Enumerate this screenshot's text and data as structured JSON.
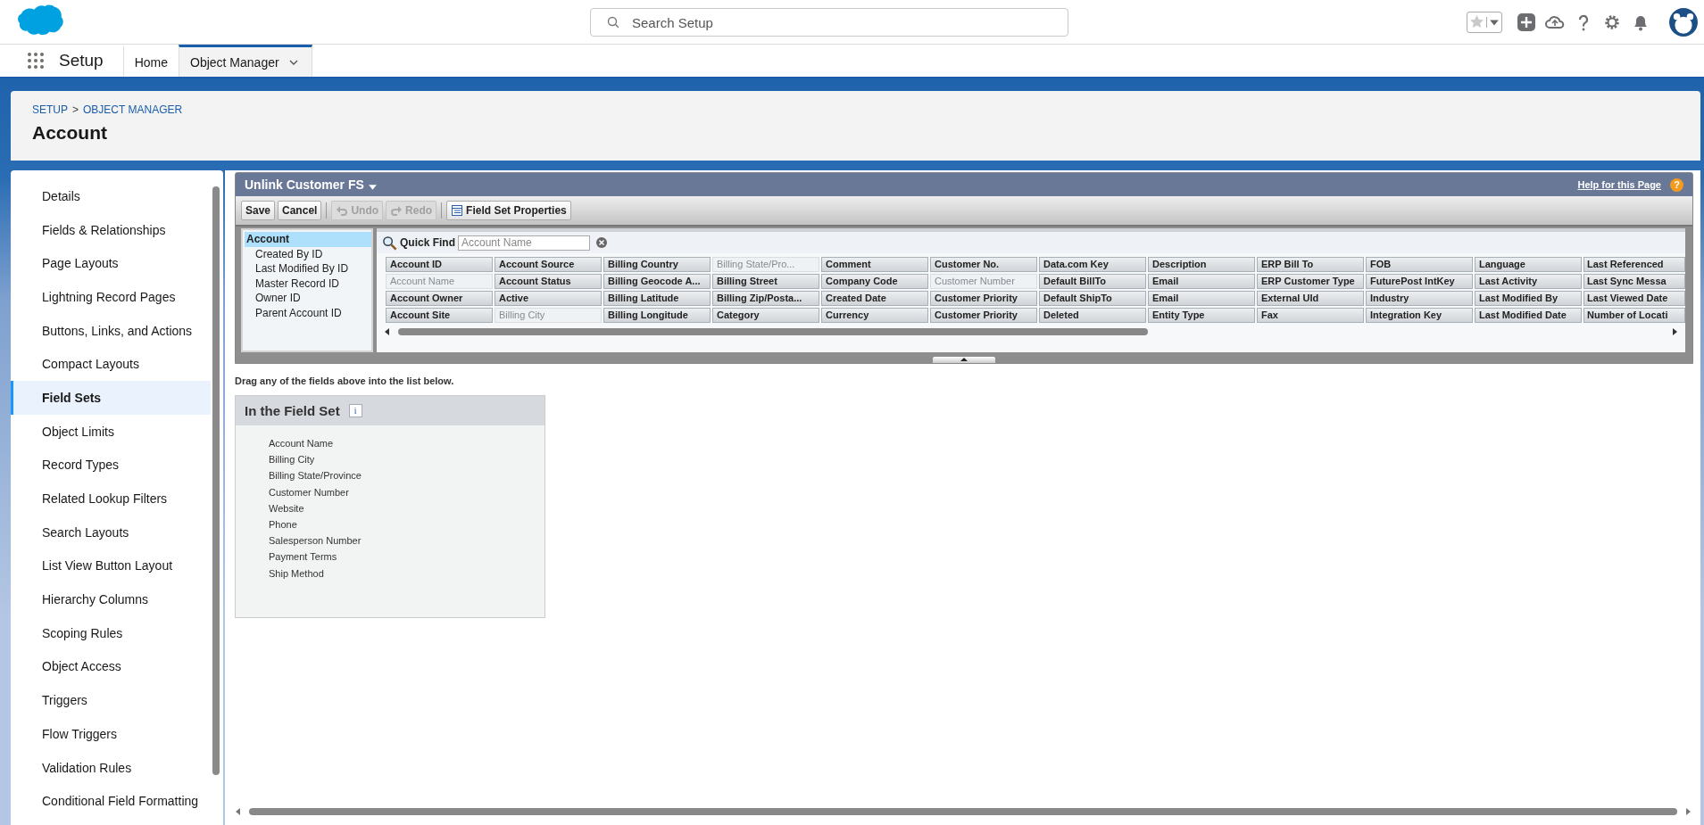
{
  "global_header": {
    "search": {
      "placeholder": "Search Setup"
    }
  },
  "nav": {
    "app_name": "Setup",
    "tabs": [
      {
        "label": "Home",
        "selected": false,
        "has_menu": false
      },
      {
        "label": "Object Manager",
        "selected": true,
        "has_menu": true
      }
    ]
  },
  "page_header": {
    "breadcrumbs": [
      "SETUP",
      "OBJECT MANAGER"
    ],
    "separator": ">",
    "title": "Account"
  },
  "sidebar": {
    "items": [
      {
        "label": "Details",
        "selected": false
      },
      {
        "label": "Fields & Relationships",
        "selected": false
      },
      {
        "label": "Page Layouts",
        "selected": false
      },
      {
        "label": "Lightning Record Pages",
        "selected": false
      },
      {
        "label": "Buttons, Links, and Actions",
        "selected": false
      },
      {
        "label": "Compact Layouts",
        "selected": false
      },
      {
        "label": "Field Sets",
        "selected": true
      },
      {
        "label": "Object Limits",
        "selected": false
      },
      {
        "label": "Record Types",
        "selected": false
      },
      {
        "label": "Related Lookup Filters",
        "selected": false
      },
      {
        "label": "Search Layouts",
        "selected": false
      },
      {
        "label": "List View Button Layout",
        "selected": false
      },
      {
        "label": "Hierarchy Columns",
        "selected": false
      },
      {
        "label": "Scoping Rules",
        "selected": false
      },
      {
        "label": "Object Access",
        "selected": false
      },
      {
        "label": "Triggers",
        "selected": false
      },
      {
        "label": "Flow Triggers",
        "selected": false
      },
      {
        "label": "Validation Rules",
        "selected": false
      },
      {
        "label": "Conditional Field Formatting",
        "selected": false
      }
    ]
  },
  "builder": {
    "title": "Unlink Customer FS",
    "help_link": "Help for this Page",
    "help_badge": "?",
    "toolbar": [
      {
        "label": "Save",
        "disabled": false,
        "kind": "text"
      },
      {
        "label": "Cancel",
        "disabled": false,
        "kind": "text"
      },
      {
        "label": "Undo",
        "disabled": true,
        "kind": "undo"
      },
      {
        "label": "Redo",
        "disabled": true,
        "kind": "redo"
      },
      {
        "label": "Field Set Properties",
        "disabled": false,
        "kind": "properties"
      }
    ],
    "tree": [
      {
        "label": "Account",
        "selected": true,
        "children": [
          {
            "label": "Created By ID",
            "selected": false
          },
          {
            "label": "Last Modified By ID",
            "selected": false
          },
          {
            "label": "Master Record ID",
            "selected": false
          },
          {
            "label": "Owner ID",
            "selected": false
          },
          {
            "label": "Parent Account ID",
            "selected": false
          }
        ]
      }
    ],
    "quick_find": {
      "label": "Quick Find",
      "placeholder": "Account Name"
    },
    "field_columns": [
      [
        {
          "label": "Account ID",
          "in_set": false
        },
        {
          "label": "Account Name",
          "in_set": true
        },
        {
          "label": "Account Owner",
          "in_set": false
        },
        {
          "label": "Account Site",
          "in_set": false
        }
      ],
      [
        {
          "label": "Account Source",
          "in_set": false
        },
        {
          "label": "Account Status",
          "in_set": false
        },
        {
          "label": "Active",
          "in_set": false
        },
        {
          "label": "Billing City",
          "in_set": true
        }
      ],
      [
        {
          "label": "Billing Country",
          "in_set": false
        },
        {
          "label": "Billing Geocode A...",
          "in_set": false
        },
        {
          "label": "Billing Latitude",
          "in_set": false
        },
        {
          "label": "Billing Longitude",
          "in_set": false
        }
      ],
      [
        {
          "label": "Billing State/Pro...",
          "in_set": true
        },
        {
          "label": "Billing Street",
          "in_set": false
        },
        {
          "label": "Billing Zip/Posta...",
          "in_set": false
        },
        {
          "label": "Category",
          "in_set": false
        }
      ],
      [
        {
          "label": "Comment",
          "in_set": false
        },
        {
          "label": "Company Code",
          "in_set": false
        },
        {
          "label": "Created Date",
          "in_set": false
        },
        {
          "label": "Currency",
          "in_set": false
        }
      ],
      [
        {
          "label": "Customer No.",
          "in_set": false
        },
        {
          "label": "Customer Number",
          "in_set": true
        },
        {
          "label": "Customer Priority",
          "in_set": false
        },
        {
          "label": "Customer Priority",
          "in_set": false
        }
      ],
      [
        {
          "label": "Data.com Key",
          "in_set": false
        },
        {
          "label": "Default BillTo",
          "in_set": false
        },
        {
          "label": "Default ShipTo",
          "in_set": false
        },
        {
          "label": "Deleted",
          "in_set": false
        }
      ],
      [
        {
          "label": "Description",
          "in_set": false
        },
        {
          "label": "Email",
          "in_set": false
        },
        {
          "label": "Email",
          "in_set": false
        },
        {
          "label": "Entity Type",
          "in_set": false
        }
      ],
      [
        {
          "label": "ERP Bill To",
          "in_set": false
        },
        {
          "label": "ERP Customer Type",
          "in_set": false
        },
        {
          "label": "External UId",
          "in_set": false
        },
        {
          "label": "Fax",
          "in_set": false
        }
      ],
      [
        {
          "label": "FOB",
          "in_set": false
        },
        {
          "label": "FuturePost IntKey",
          "in_set": false
        },
        {
          "label": "Industry",
          "in_set": false
        },
        {
          "label": "Integration Key",
          "in_set": false
        }
      ],
      [
        {
          "label": "Language",
          "in_set": false
        },
        {
          "label": "Last Activity",
          "in_set": false
        },
        {
          "label": "Last Modified By",
          "in_set": false
        },
        {
          "label": "Last Modified Date",
          "in_set": false
        }
      ],
      [
        {
          "label": "Last Referenced",
          "in_set": false
        },
        {
          "label": "Last Sync Messa",
          "in_set": false
        },
        {
          "label": "Last Viewed Date",
          "in_set": false
        },
        {
          "label": "Number of Locati",
          "in_set": false
        }
      ]
    ]
  },
  "instruction": "Drag any of the fields above into the list below.",
  "field_set": {
    "title": "In the Field Set",
    "info_badge": "i",
    "items": [
      "Account Name",
      "Billing City",
      "Billing State/Province",
      "Customer Number",
      "Website",
      "Phone",
      "Salesperson Number",
      "Payment Terms",
      "Ship Method"
    ]
  }
}
